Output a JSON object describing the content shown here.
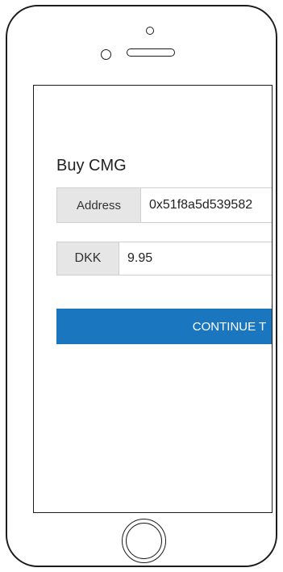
{
  "page": {
    "title": "Buy CMG"
  },
  "address": {
    "label": "Address",
    "value": "0x51f8a5d539582"
  },
  "amount": {
    "currency_label": "DKK",
    "value": "9.95"
  },
  "actions": {
    "continue_label": "CONTINUE T"
  },
  "colors": {
    "primary": "#1b76c0",
    "addon_bg": "#e6e6e6",
    "frame": "#1c1c1c"
  }
}
